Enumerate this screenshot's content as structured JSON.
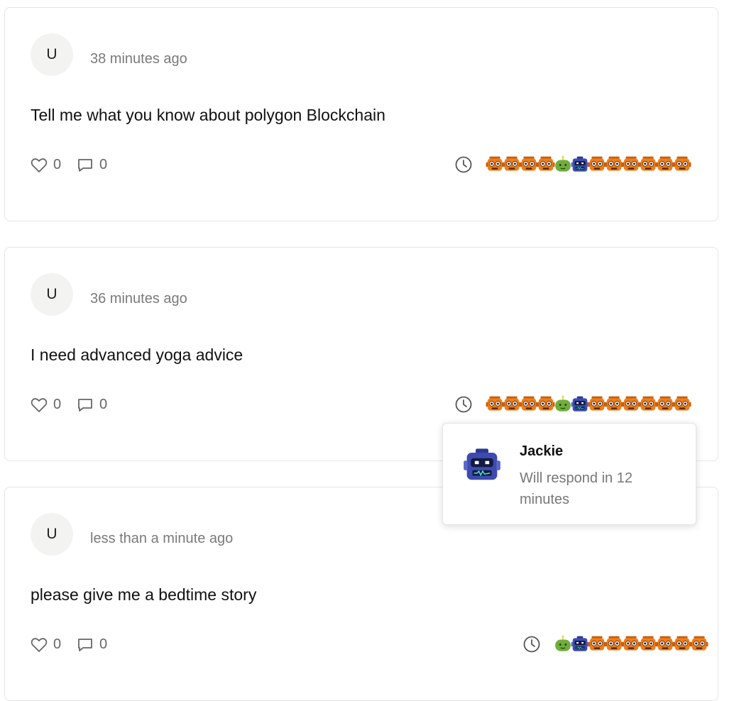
{
  "posts": [
    {
      "avatar": "U",
      "time": "38 minutes ago",
      "question": "Tell me what you know about polygon Blockchain",
      "likes": "0",
      "comments": "0",
      "bots": [
        "orange",
        "orange",
        "orange",
        "orange",
        "green",
        "blue",
        "orange",
        "orange",
        "orange",
        "orange",
        "orange",
        "orange"
      ]
    },
    {
      "avatar": "U",
      "time": "36 minutes ago",
      "question": "I need advanced yoga advice",
      "likes": "0",
      "comments": "0",
      "bots": [
        "orange",
        "orange",
        "orange",
        "orange",
        "green",
        "blue",
        "orange",
        "orange",
        "orange",
        "orange",
        "orange",
        "orange"
      ]
    },
    {
      "avatar": "U",
      "time": "less than a minute ago",
      "question": "please give me a bedtime story",
      "likes": "0",
      "comments": "0",
      "bots": [
        "green",
        "blue",
        "orange",
        "orange",
        "orange",
        "orange",
        "orange",
        "orange",
        "orange"
      ]
    }
  ],
  "tooltip": {
    "name": "Jackie",
    "message": "Will respond in 12 minutes",
    "bot": "blue"
  },
  "icons": {
    "like": "heart-icon",
    "comment": "comment-icon",
    "pending": "clock-icon"
  },
  "colors": {
    "orange_bot": "#f07d1a",
    "green_bot": "#6fae3c",
    "blue_bot": "#3d4bb0"
  }
}
